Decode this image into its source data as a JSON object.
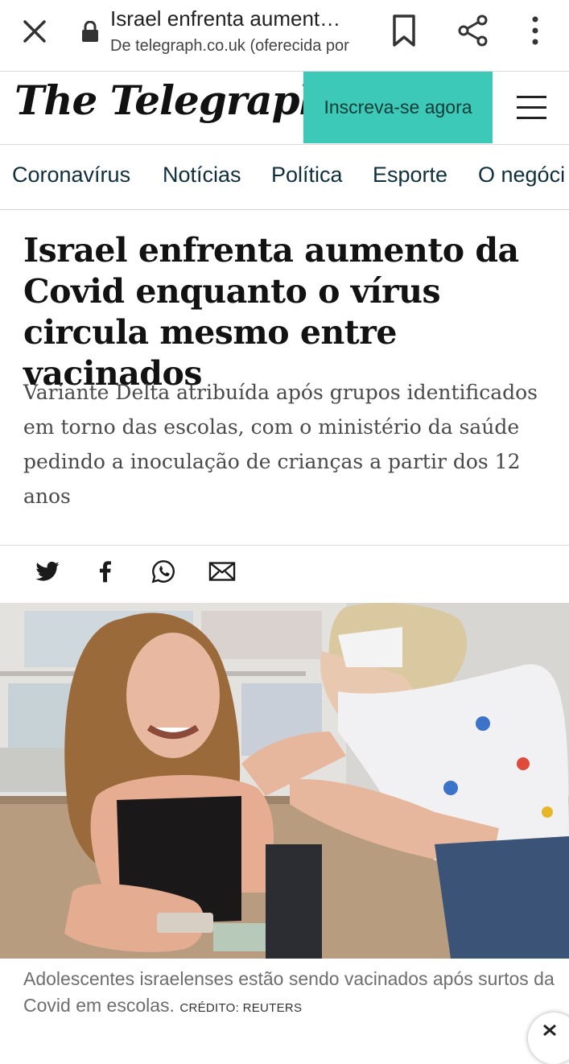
{
  "browser": {
    "title": "Israel enfrenta aument…",
    "origin": "De telegraph.co.uk (oferecida por"
  },
  "site": {
    "logo": "The Telegraph",
    "subscribe_label": "Inscreva-se agora",
    "brand_color": "#3cc9b7"
  },
  "nav": {
    "items": [
      "Coronavírus",
      "Notícias",
      "Política",
      "Esporte",
      "O negóci"
    ]
  },
  "article": {
    "headline": "Israel enfrenta aumento da Covid enquanto o vírus circula mesmo entre vacinados",
    "standfirst": "Variante Delta atribuída após grupos identificados em torno das escolas, com o ministério da saúde pedindo a inoculação de crianças a partir dos 12 anos",
    "share_icons": [
      "twitter-icon",
      "facebook-icon",
      "whatsapp-icon",
      "email-icon"
    ],
    "caption": "Adolescentes israelenses estão sendo vacinados após surtos da Covid em escolas.",
    "credit": "CRÉDITO: REUTERS"
  }
}
